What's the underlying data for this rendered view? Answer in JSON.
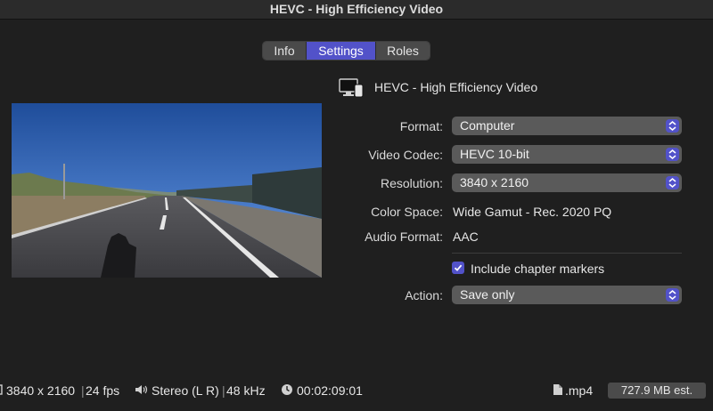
{
  "window": {
    "title": "HEVC - High Efficiency Video"
  },
  "tabs": [
    {
      "label": "Info",
      "selected": false
    },
    {
      "label": "Settings",
      "selected": true
    },
    {
      "label": "Roles",
      "selected": false
    }
  ],
  "preset": {
    "icon": "computer-device-icon",
    "title": "HEVC - High Efficiency Video"
  },
  "settings": {
    "format": {
      "label": "Format:",
      "value": "Computer"
    },
    "video_codec": {
      "label": "Video Codec:",
      "value": "HEVC 10-bit"
    },
    "resolution": {
      "label": "Resolution:",
      "value": "3840 x 2160"
    },
    "color_space": {
      "label": "Color Space:",
      "value": "Wide Gamut - Rec. 2020 PQ"
    },
    "audio_format": {
      "label": "Audio Format:",
      "value": "AAC"
    },
    "chapter_markers": {
      "label": "Include chapter markers",
      "checked": true
    },
    "action": {
      "label": "Action:",
      "value": "Save only"
    }
  },
  "status": {
    "resolution": "3840 x 2160",
    "fps": "24 fps",
    "audio_channels": "Stereo (L R)",
    "sample_rate": "48 kHz",
    "duration": "00:02:09:01",
    "extension": ".mp4",
    "estimated_size": "727.9 MB est."
  },
  "colors": {
    "accent": "#5252c9",
    "background": "#1f1f1f",
    "popup": "#5a5a5a"
  }
}
